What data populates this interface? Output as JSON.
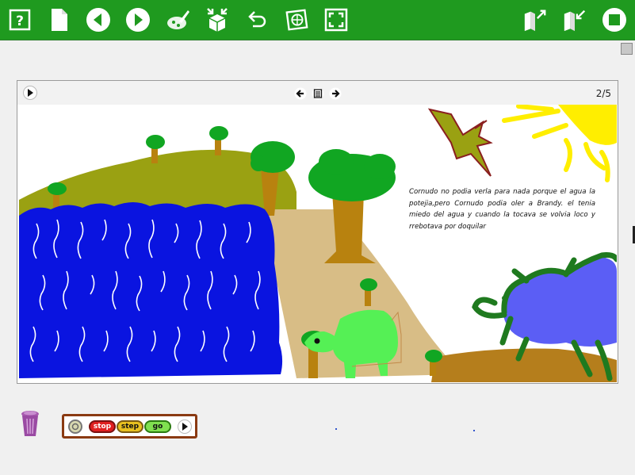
{
  "book": {
    "page_indicator": "2/5",
    "story_text": "Cornudo no podia verla para nada porque el agua la potejia,pero Cornudo podia oler a Brandy. el  tenia miedo del  agua y  cuando  la  tocava se volvia loco y rrebotava por  doquilar"
  },
  "toolbar": {
    "icons": [
      "help-icon",
      "new-page-icon",
      "previous-icon",
      "next-icon",
      "paint-icon",
      "supplies-icon",
      "undo-icon",
      "navigator-icon",
      "fullscreen-icon",
      "import-icon",
      "export-icon",
      "stop-icon"
    ]
  },
  "controls": {
    "stop_label": "stop",
    "step_label": "step",
    "go_label": "go"
  },
  "colors": {
    "toolbar": "#1f9a1f",
    "water": "#0a14e0",
    "hill": "#9aa112",
    "sand": "#d8bd86",
    "sun": "#ffee00",
    "controls_border": "#8a3a12"
  }
}
